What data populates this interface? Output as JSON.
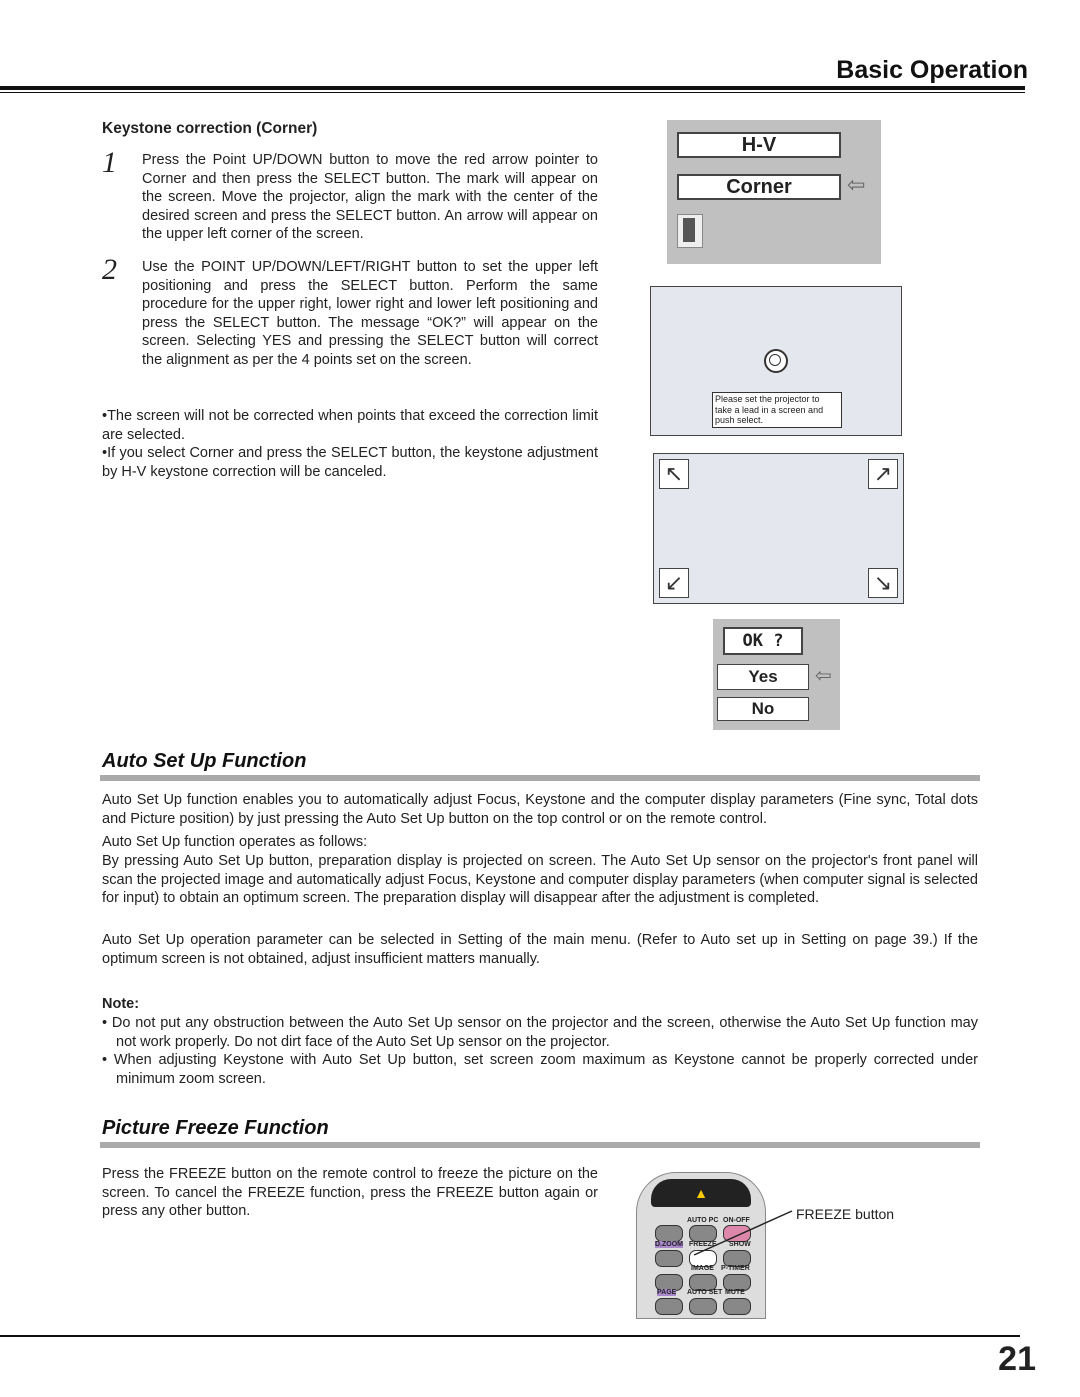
{
  "header": {
    "title": "Basic Operation"
  },
  "keystone": {
    "heading": "Keystone correction (Corner)",
    "steps": [
      {
        "num": "1",
        "text": "Press the Point UP/DOWN button to move the red arrow pointer to Corner and then press the SELECT button. The mark will appear on the screen. Move the projector, align the mark with the center of the desired screen and press the SELECT button. An arrow will appear on the upper left corner of the screen."
      },
      {
        "num": "2",
        "text": "Use the POINT UP/DOWN/LEFT/RIGHT button to set the upper left positioning and press the SELECT button. Perform the same procedure for the upper right, lower right and lower left positioning and press the SELECT button. The message “OK?” will appear on the screen. Selecting YES and pressing the SELECT button will correct the alignment as per the 4 points set on the screen."
      }
    ],
    "bullets": [
      "•The screen will not be corrected when points that exceed the correction limit are selected.",
      "•If you select Corner and press the SELECT button, the keystone adjustment by H-V keystone correction will be canceled."
    ],
    "menu": {
      "item1": "H-V",
      "item2": "Corner"
    },
    "screen_message": "Please set the projector to take a lead in a screen and push select.",
    "confirm": {
      "title": "OK ?",
      "yes": "Yes",
      "no": "No"
    }
  },
  "auto_setup": {
    "title": "Auto Set Up Function",
    "paragraphs": [
      "Auto Set Up function enables you to automatically adjust Focus, Keystone and the computer display parameters (Fine sync, Total dots and Picture position) by just pressing the Auto Set Up button on the top control or on the remote control.",
      "Auto Set Up function operates as follows:",
      "By pressing Auto Set Up button, preparation display is projected on screen. The Auto Set Up sensor on the projector's front panel will scan the projected image and automatically adjust Focus, Keystone and computer display parameters (when computer signal is selected for input) to obtain an optimum screen. The preparation display will disappear after the adjustment is completed.",
      "Auto Set Up operation parameter can be selected in Setting of the main menu. (Refer to Auto set up in Setting on page 39.) If the optimum screen is not obtained, adjust insufficient matters manually."
    ],
    "note_label": "Note:",
    "notes": [
      "• Do not put any obstruction between the Auto Set Up sensor on the projector and the screen, otherwise the Auto Set Up function may not work properly. Do not dirt face of the Auto Set Up sensor on the projector.",
      "• When adjusting Keystone with Auto Set Up button, set screen zoom maximum as Keystone cannot be properly corrected under minimum zoom screen."
    ]
  },
  "freeze": {
    "title": "Picture Freeze Function",
    "text": "Press the FREEZE button on the remote control to freeze the picture on the screen.  To cancel the FREEZE function, press the FREEZE button again or press any other button.",
    "callout": "FREEZE button",
    "remote_labels": [
      "AUTO PC",
      "ON-OFF",
      "D.ZOOM",
      "FREEZE",
      "SHOW",
      "IMAGE",
      "P-TIMER",
      "PAGE",
      "AUTO SET",
      "MUTE"
    ]
  },
  "page_number": "21"
}
